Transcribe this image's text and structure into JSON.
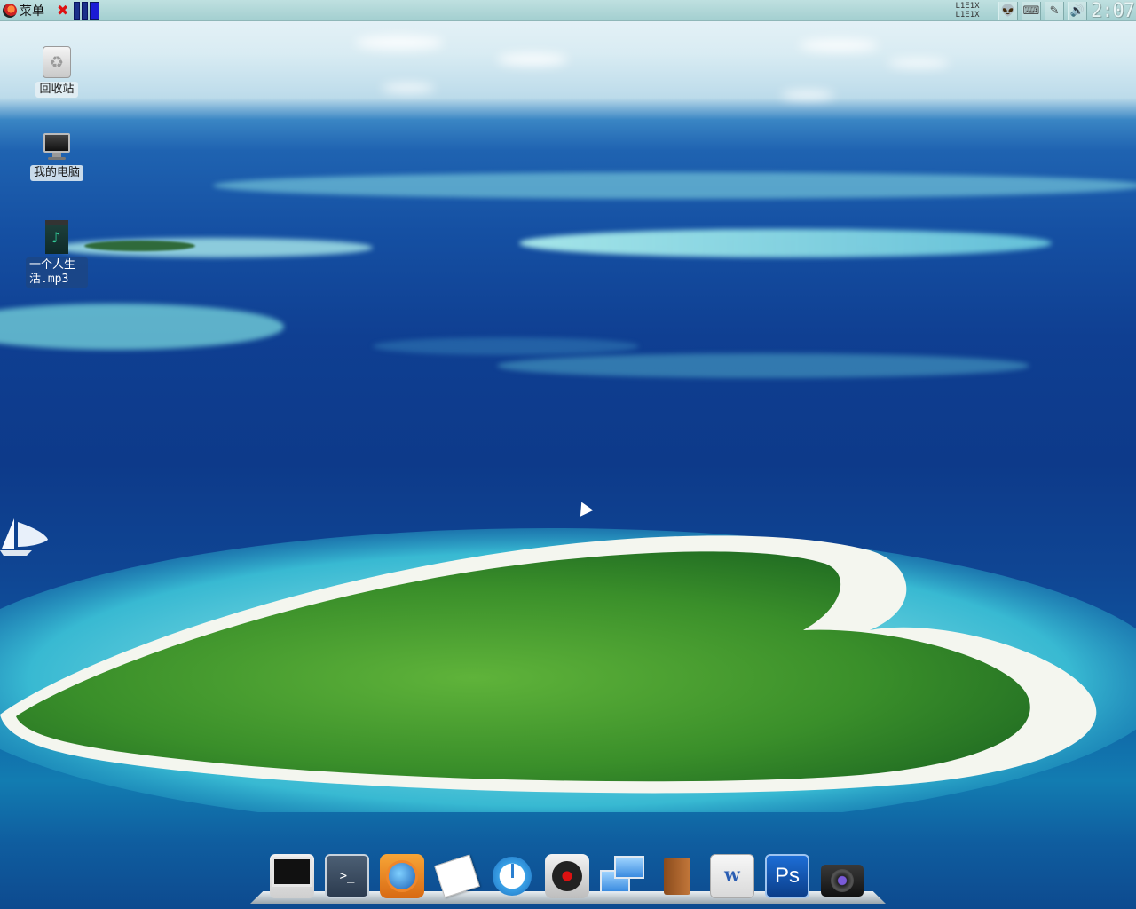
{
  "top_panel": {
    "menu_label": "菜单",
    "close_glyph": "✖",
    "pager": {
      "desktops": 3,
      "active": 3
    },
    "tray": {
      "net_meter_top": "L1E1X",
      "net_meter_bottom": "L1E1X",
      "icons": [
        "alien-icon",
        "keyboard-icon",
        "pen-icon",
        "volume-icon"
      ],
      "clock": "2:07"
    }
  },
  "desktop_icons": [
    {
      "label": "回收站",
      "icon": "trash-icon"
    },
    {
      "label": "我的电脑",
      "icon": "computer-icon"
    },
    {
      "label": "一个人生活.mp3",
      "label_line1": "一个人生",
      "label_line2": "活.mp3",
      "icon": "media-file-icon",
      "selected": true
    }
  ],
  "dock": {
    "items": [
      {
        "name": "monitor",
        "icon": "display-icon"
      },
      {
        "name": "terminal",
        "icon": "terminal-icon",
        "glyph": ">_"
      },
      {
        "name": "firefox",
        "icon": "firefox-icon"
      },
      {
        "name": "text-editor",
        "icon": "notepad-icon"
      },
      {
        "name": "clock",
        "icon": "clock-icon"
      },
      {
        "name": "recorder",
        "icon": "record-icon"
      },
      {
        "name": "network",
        "icon": "network-icon"
      },
      {
        "name": "contacts",
        "icon": "address-book-icon"
      },
      {
        "name": "word",
        "icon": "word-icon",
        "glyph": "W"
      },
      {
        "name": "photoshop",
        "icon": "photoshop-icon",
        "glyph": "Ps"
      },
      {
        "name": "camera",
        "icon": "camera-icon"
      }
    ]
  },
  "colors": {
    "panel": "#a3cfd0",
    "sea_deep": "#0d3a8a",
    "lagoon": "#7fe0e6",
    "island_green": "#3f9a2f",
    "beach": "#f3f7f2"
  }
}
